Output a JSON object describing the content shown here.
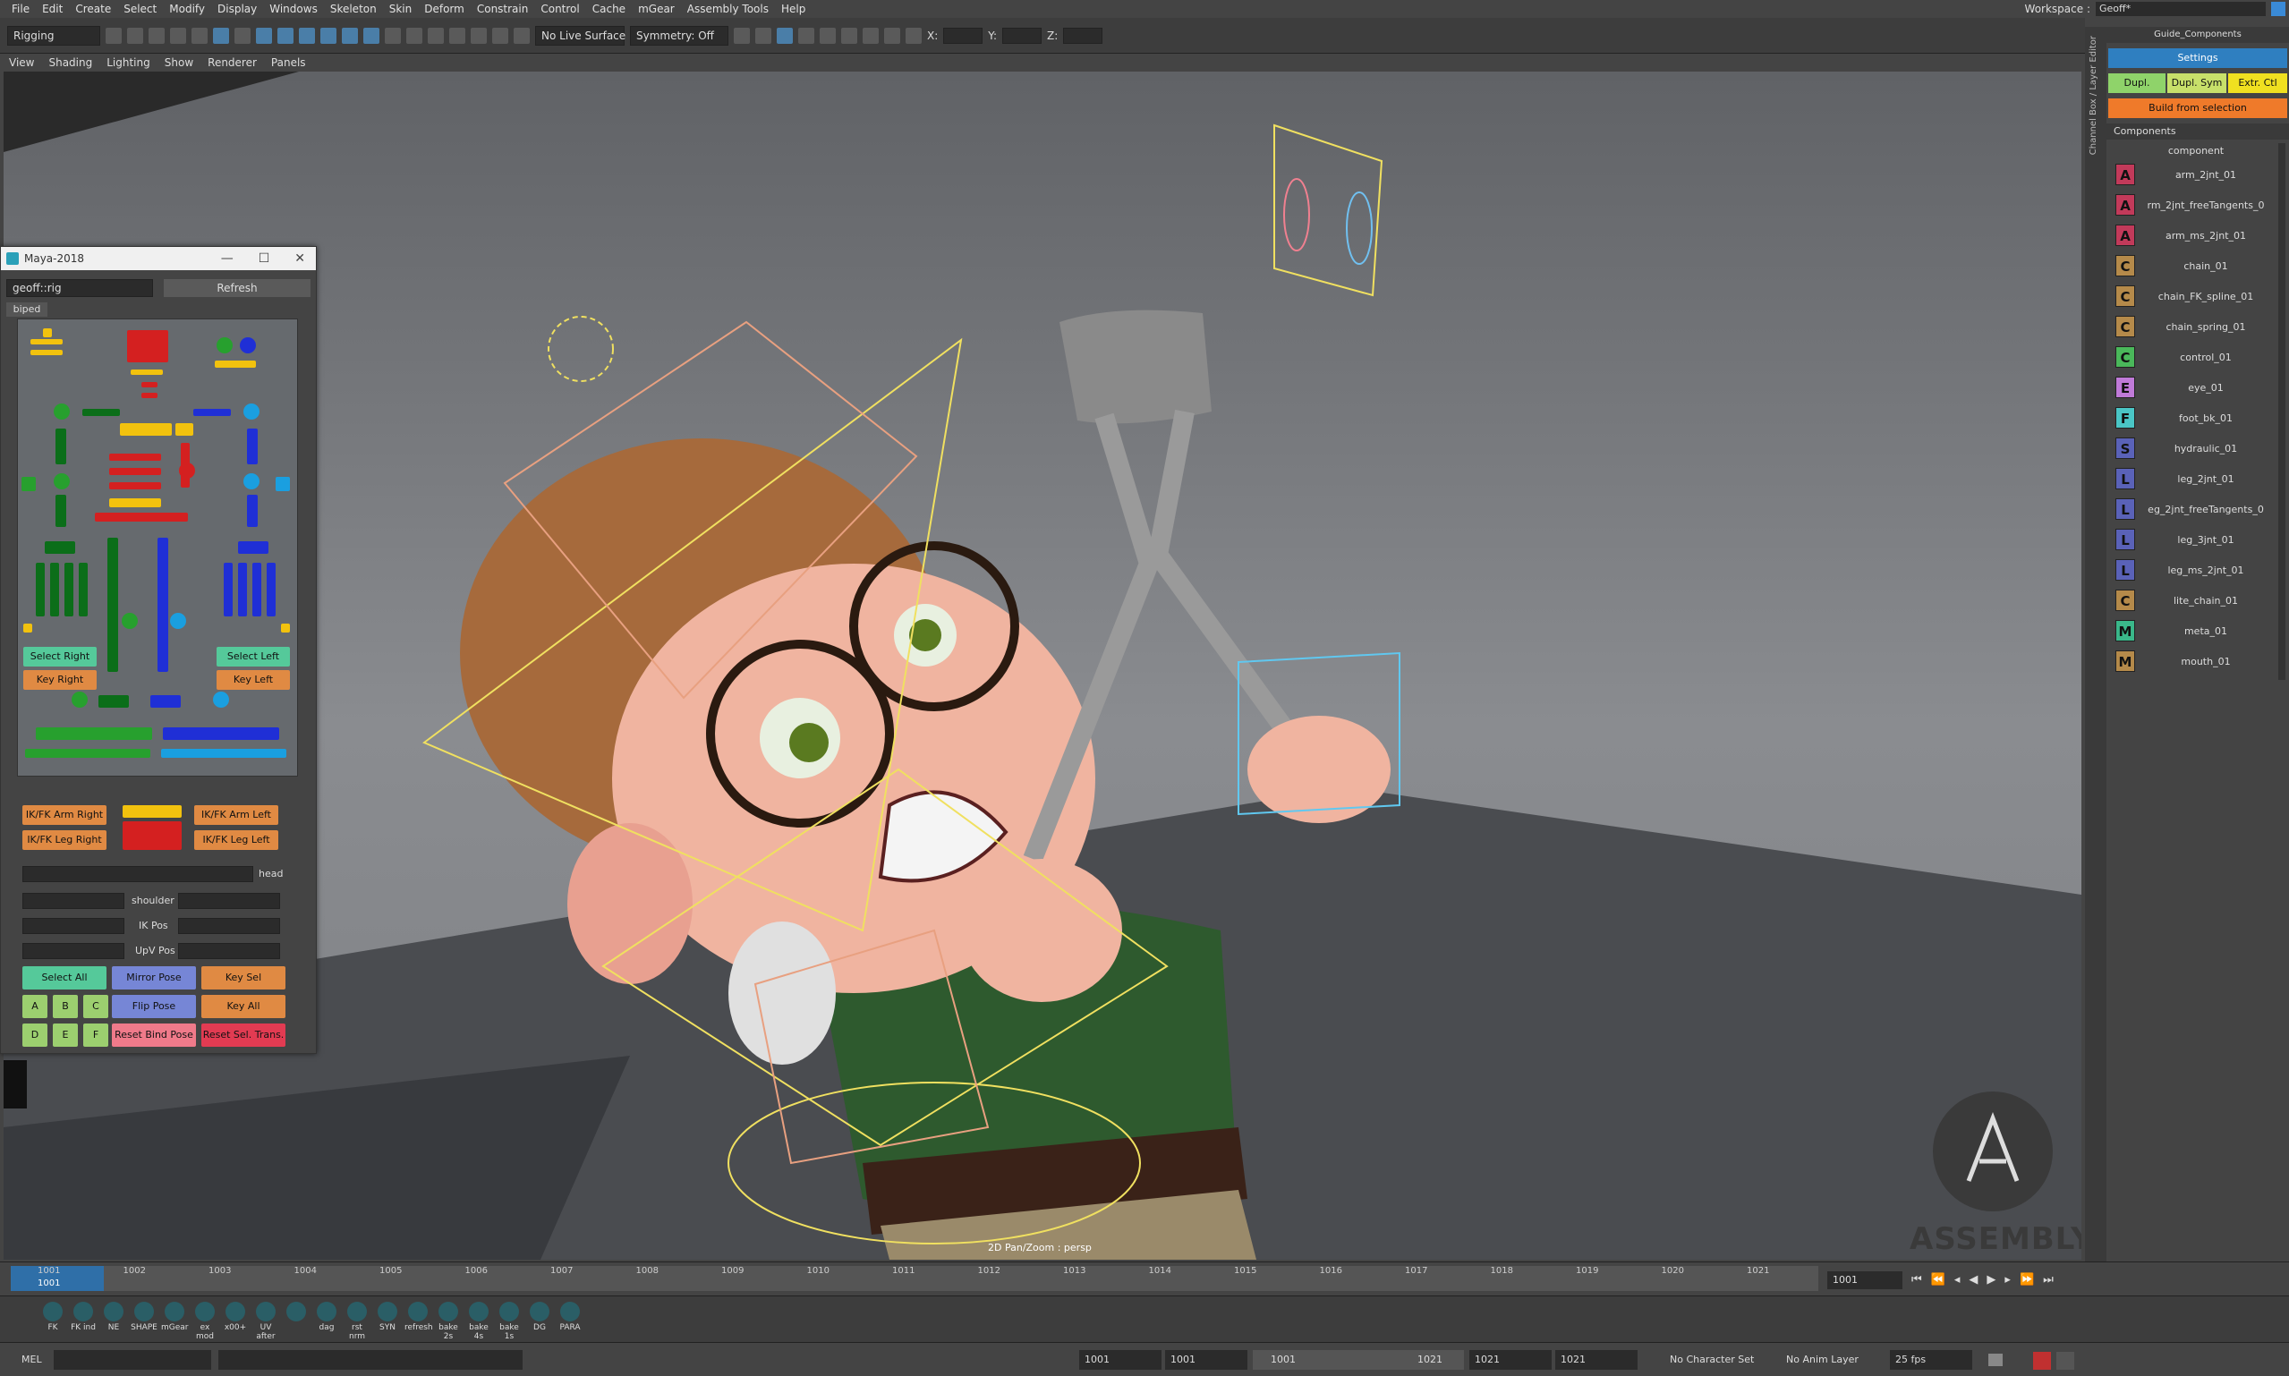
{
  "menubar": {
    "items": [
      "File",
      "Edit",
      "Create",
      "Select",
      "Modify",
      "Display",
      "Windows",
      "Skeleton",
      "Skin",
      "Deform",
      "Constrain",
      "Control",
      "Cache",
      "mGear",
      "Assembly Tools",
      "Help"
    ],
    "workspace_label": "Workspace :",
    "workspace_value": "Geoff*"
  },
  "shelf": {
    "mode": "Rigging",
    "live_surface": "No Live Surface",
    "symmetry": "Symmetry: Off",
    "x_label": "X:",
    "y_label": "Y:",
    "z_label": "Z:"
  },
  "panel_menu": {
    "items": [
      "View",
      "Shading",
      "Lighting",
      "Show",
      "Renderer",
      "Panels"
    ]
  },
  "viewport": {
    "camera_label": "2D Pan/Zoom : persp",
    "logo_text": "ASSEMBLY"
  },
  "picker": {
    "title": "Maya-2018",
    "namespace": "geoff::rig",
    "refresh": "Refresh",
    "tab": "biped",
    "select_right": "Select Right",
    "select_left": "Select Left",
    "key_right": "Key Right",
    "key_left": "Key Left",
    "ikfk_arm_right": "IK/FK Arm Right",
    "ikfk_arm_left": "IK/FK Arm Left",
    "ikfk_leg_right": "IK/FK Leg Right",
    "ikfk_leg_left": "IK/FK Leg Left",
    "head": "head",
    "shoulder": "shoulder",
    "ik_pos": "IK Pos",
    "upv_pos": "UpV Pos",
    "select_all": "Select All",
    "mirror_pose": "Mirror Pose",
    "key_sel": "Key Sel",
    "flip_pose": "Flip Pose",
    "key_all": "Key All",
    "reset_bind_pose": "Reset Bind Pose",
    "reset_sel_trans": "Reset Sel. Trans.",
    "letters_row1": [
      "A",
      "B",
      "C"
    ],
    "letters_row2": [
      "D",
      "E",
      "F"
    ]
  },
  "right_panel": {
    "strip_label": "Channel Box / Layer Editor",
    "tab": "Guide_Components",
    "settings": "Settings",
    "dupl": "Dupl.",
    "dupl_sym": "Dupl. Sym",
    "extr_ctl": "Extr. Ctl",
    "build": "Build from selection",
    "components_title": "Components",
    "column_header": "component",
    "components": [
      {
        "icon": "A",
        "name": "arm_2jnt_01",
        "color": "#c23a5a"
      },
      {
        "icon": "A",
        "name": "rm_2jnt_freeTangents_0",
        "color": "#c23a5a"
      },
      {
        "icon": "A",
        "name": "arm_ms_2jnt_01",
        "color": "#c23a5a"
      },
      {
        "icon": "C",
        "name": "chain_01",
        "color": "#b58a4a"
      },
      {
        "icon": "C",
        "name": "chain_FK_spline_01",
        "color": "#b58a4a"
      },
      {
        "icon": "C",
        "name": "chain_spring_01",
        "color": "#b58a4a"
      },
      {
        "icon": "C",
        "name": "control_01",
        "color": "#4ab85a"
      },
      {
        "icon": "E",
        "name": "eye_01",
        "color": "#c07ad8"
      },
      {
        "icon": "F",
        "name": "foot_bk_01",
        "color": "#4ac6c6"
      },
      {
        "icon": "S",
        "name": "hydraulic_01",
        "color": "#5a62b8"
      },
      {
        "icon": "L",
        "name": "leg_2jnt_01",
        "color": "#5a62b8"
      },
      {
        "icon": "L",
        "name": "eg_2jnt_freeTangents_0",
        "color": "#5a62b8"
      },
      {
        "icon": "L",
        "name": "leg_3jnt_01",
        "color": "#5a62b8"
      },
      {
        "icon": "L",
        "name": "leg_ms_2jnt_01",
        "color": "#5a62b8"
      },
      {
        "icon": "C",
        "name": "lite_chain_01",
        "color": "#b58a4a"
      },
      {
        "icon": "M",
        "name": "meta_01",
        "color": "#3ab88a"
      },
      {
        "icon": "M",
        "name": "mouth_01",
        "color": "#b58a4a"
      }
    ]
  },
  "timeline": {
    "ticks": [
      "1001",
      "1002",
      "1003",
      "1004",
      "1005",
      "1006",
      "1007",
      "1008",
      "1009",
      "1010",
      "1011",
      "1012",
      "1013",
      "1014",
      "1015",
      "1016",
      "1017",
      "1018",
      "1019",
      "1020",
      "1021"
    ],
    "current_label": "1001",
    "current_frame": "1001"
  },
  "shelf_bottom": {
    "buttons": [
      "FK",
      "FK ind",
      "NE",
      "SHAPE",
      "mGear",
      "ex mod",
      "x00+",
      "UV after",
      "",
      "dag",
      "rst nrm",
      "SYN",
      "refresh",
      "bake 2s",
      "bake 4s",
      "bake 1s",
      "DG",
      "PARA"
    ]
  },
  "cmdline": {
    "mel": "MEL",
    "start": "1001",
    "anim_start": "1001",
    "range_start": "1001",
    "range_end": "1021",
    "anim_end": "1021",
    "end": "1021",
    "char_set": "No Character Set",
    "anim_layer": "No Anim Layer",
    "fps": "25 fps"
  }
}
